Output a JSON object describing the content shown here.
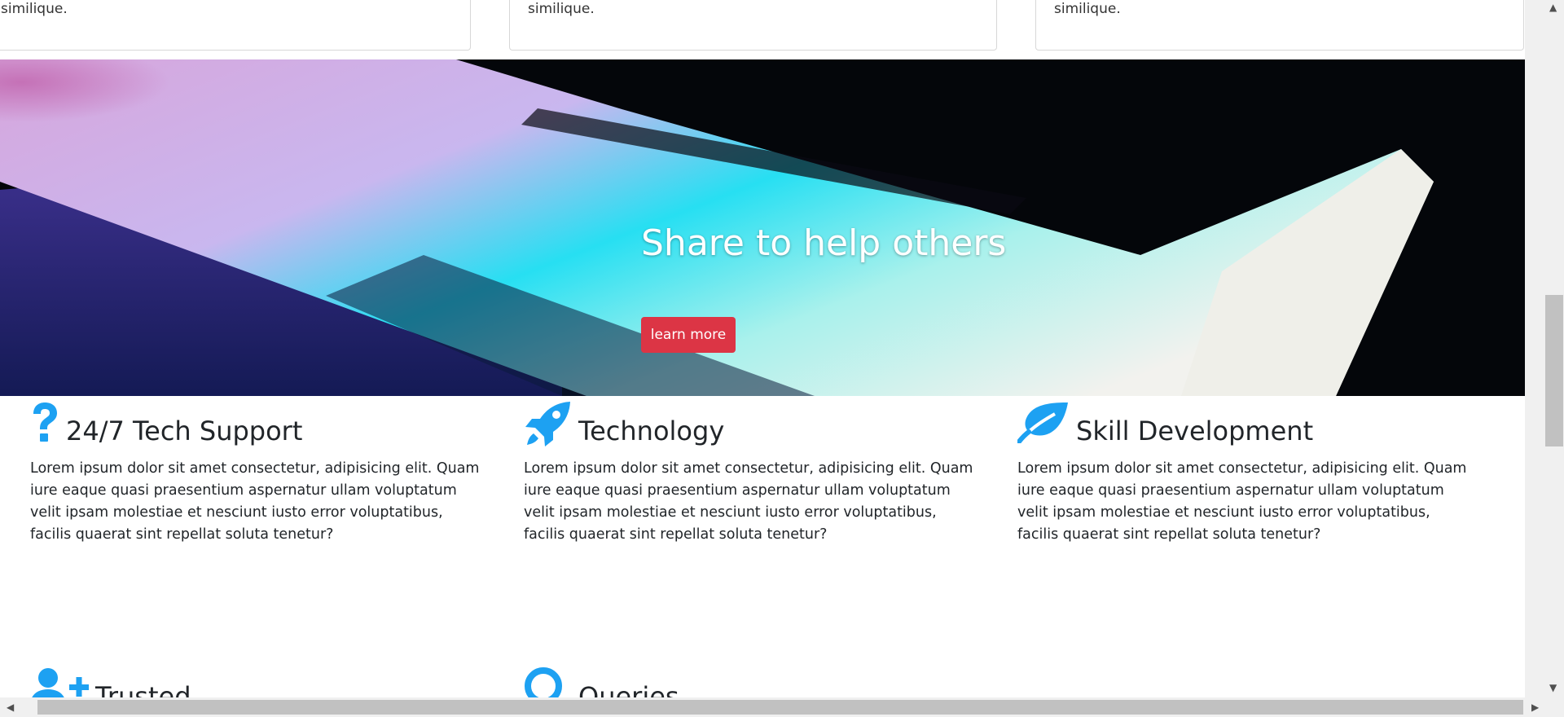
{
  "cards": [
    {
      "text": "similique."
    },
    {
      "text": "similique."
    },
    {
      "text": "similique."
    }
  ],
  "hero": {
    "title": "Share to help others",
    "button_label": "learn more"
  },
  "features": [
    {
      "icon": "question-icon",
      "title": "24/7 Tech Support",
      "text": "Lorem ipsum dolor sit amet consectetur, adipisicing elit. Quam iure eaque quasi praesentium aspernatur ullam voluptatum velit ipsam molestiae et nesciunt iusto error voluptatibus, facilis quaerat sint repellat soluta tenetur?"
    },
    {
      "icon": "rocket-icon",
      "title": "Technology",
      "text": "Lorem ipsum dolor sit amet consectetur, adipisicing elit. Quam iure eaque quasi praesentium aspernatur ullam voluptatum velit ipsam molestiae et nesciunt iusto error voluptatibus, facilis quaerat sint repellat soluta tenetur?"
    },
    {
      "icon": "leaf-icon",
      "title": "Skill Development",
      "text": "Lorem ipsum dolor sit amet consectetur, adipisicing elit. Quam iure eaque quasi praesentium aspernatur ullam voluptatum velit ipsam molestiae et nesciunt iusto error voluptatibus, facilis quaerat sint repellat soluta tenetur?"
    },
    {
      "icon": "user-plus-icon",
      "title": "Trusted",
      "text": ""
    },
    {
      "icon": "search-icon",
      "title": "Queries",
      "text": ""
    }
  ],
  "colors": {
    "accent_icon": "#1da1f2",
    "button": "#dc3545"
  }
}
